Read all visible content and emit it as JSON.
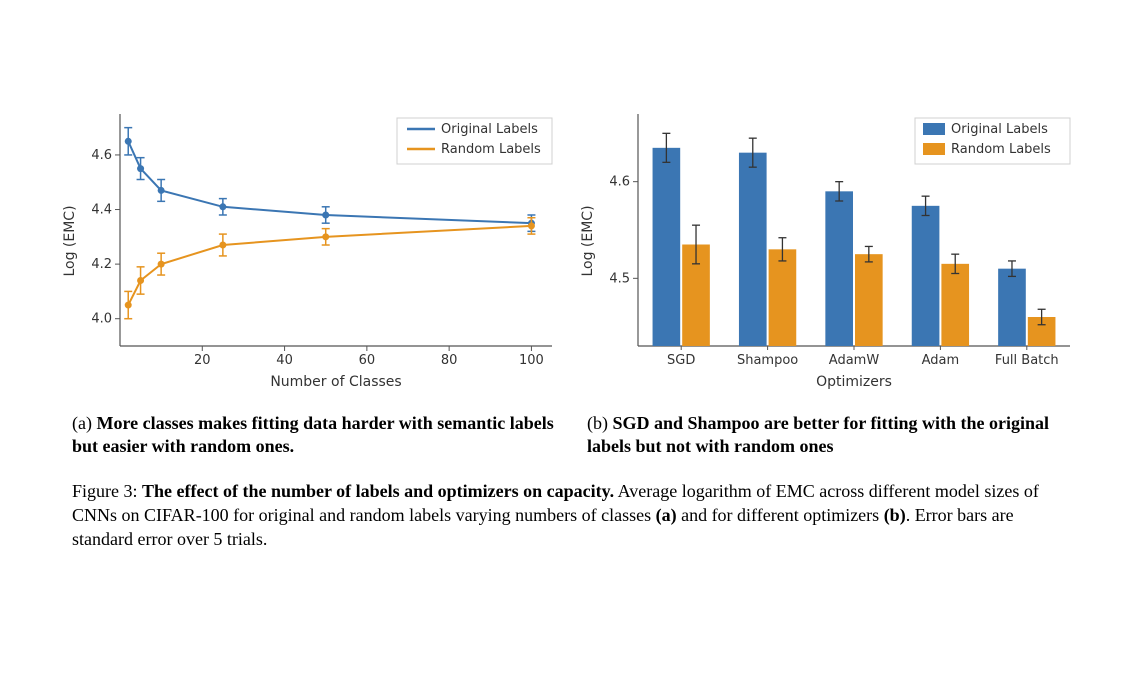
{
  "chart_data": [
    {
      "id": "a",
      "type": "line",
      "xlabel": "Number of Classes",
      "ylabel": "Log (EMC)",
      "xlim": [
        0,
        105
      ],
      "ylim": [
        3.9,
        4.75
      ],
      "xticks": [
        20,
        40,
        60,
        80,
        100
      ],
      "yticks": [
        4.0,
        4.2,
        4.4,
        4.6
      ],
      "legend": [
        "Original Labels",
        "Random Labels"
      ],
      "x": [
        2,
        5,
        10,
        25,
        50,
        100
      ],
      "series": [
        {
          "name": "Original Labels",
          "color": "#3b76b3",
          "values": [
            4.65,
            4.55,
            4.47,
            4.41,
            4.38,
            4.35
          ],
          "err": [
            0.05,
            0.04,
            0.04,
            0.03,
            0.03,
            0.03
          ]
        },
        {
          "name": "Random Labels",
          "color": "#e6941f",
          "values": [
            4.05,
            4.14,
            4.2,
            4.27,
            4.3,
            4.34
          ],
          "err": [
            0.05,
            0.05,
            0.04,
            0.04,
            0.03,
            0.03
          ]
        }
      ]
    },
    {
      "id": "b",
      "type": "bar",
      "xlabel": "Optimizers",
      "ylabel": "Log (EMC)",
      "ylim": [
        4.43,
        4.67
      ],
      "yticks": [
        4.5,
        4.6
      ],
      "categories": [
        "SGD",
        "Shampoo",
        "AdamW",
        "Adam",
        "Full Batch"
      ],
      "legend": [
        "Original Labels",
        "Random Labels"
      ],
      "series": [
        {
          "name": "Original Labels",
          "color": "#3b76b3",
          "values": [
            4.635,
            4.63,
            4.59,
            4.575,
            4.51
          ],
          "err": [
            0.015,
            0.015,
            0.01,
            0.01,
            0.008
          ]
        },
        {
          "name": "Random Labels",
          "color": "#e6941f",
          "values": [
            4.535,
            4.53,
            4.525,
            4.515,
            4.46
          ],
          "err": [
            0.02,
            0.012,
            0.008,
            0.01,
            0.008
          ]
        }
      ]
    }
  ],
  "subcaption_a_prefix": "(a) ",
  "subcaption_a_bold": "More classes makes fitting data harder with semantic labels but easier with random ones.",
  "subcaption_b_prefix": "(b) ",
  "subcaption_b_bold": "SGD and Shampoo are better for fitting with the original labels but not with random ones",
  "figcaption_label": "Figure 3: ",
  "figcaption_bold": "The effect of the number of labels and optimizers on capacity.",
  "figcaption_rest1": " Average logarithm of EMC across different model sizes of CNNs on CIFAR-100 for original and random labels varying numbers of classes ",
  "figcaption_bold_a": "(a)",
  "figcaption_mid": " and for different optimizers ",
  "figcaption_bold_b": "(b)",
  "figcaption_tail": ". Error bars are standard error over 5 trials."
}
